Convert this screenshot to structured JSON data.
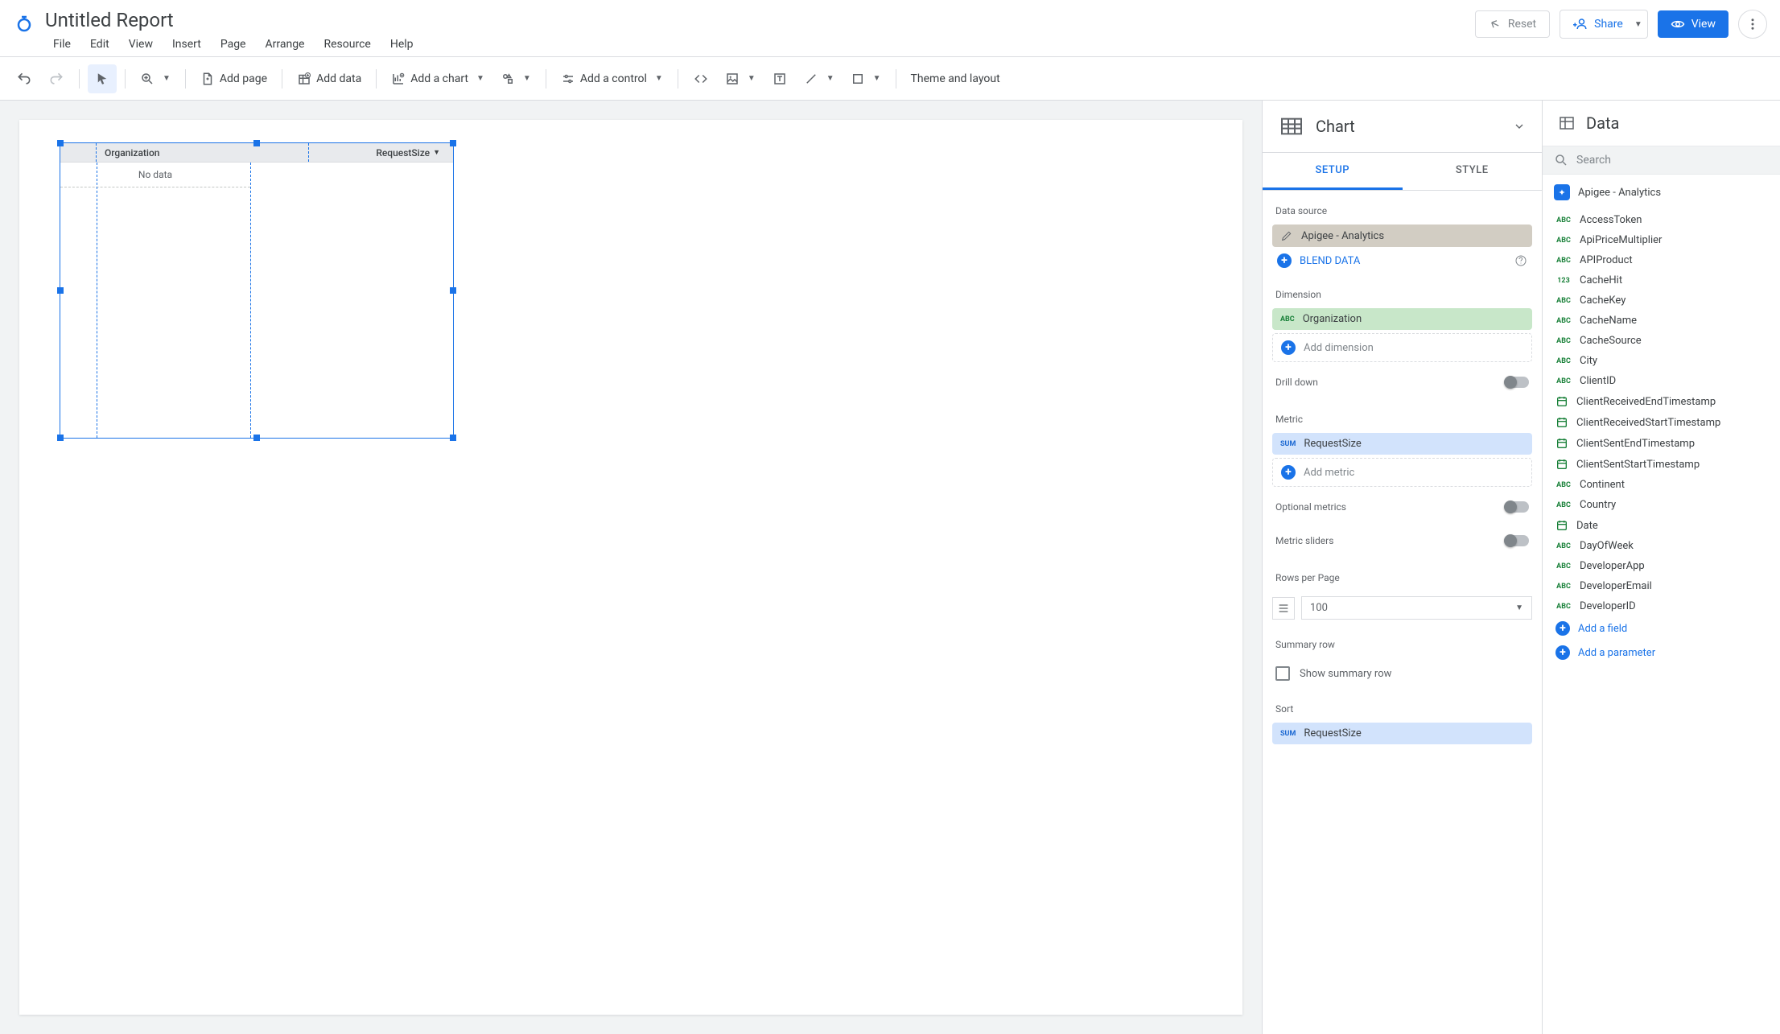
{
  "header": {
    "title": "Untitled Report",
    "menu": [
      "File",
      "Edit",
      "View",
      "Insert",
      "Page",
      "Arrange",
      "Resource",
      "Help"
    ],
    "reset": "Reset",
    "share": "Share",
    "view": "View"
  },
  "toolbar": {
    "add_page": "Add page",
    "add_data": "Add data",
    "add_chart": "Add a chart",
    "add_control": "Add a control",
    "theme": "Theme and layout"
  },
  "widget": {
    "col1": "Organization",
    "col2": "RequestSize",
    "nodata": "No data"
  },
  "chart_panel": {
    "title": "Chart",
    "tabs": {
      "setup": "SETUP",
      "style": "STYLE"
    },
    "data_source_label": "Data source",
    "data_source_value": "Apigee - Analytics",
    "blend": "BLEND DATA",
    "dimension_label": "Dimension",
    "dimension_value": "Organization",
    "add_dimension": "Add dimension",
    "drill_down": "Drill down",
    "metric_label": "Metric",
    "metric_badge": "SUM",
    "metric_value": "RequestSize",
    "add_metric": "Add metric",
    "optional_metrics": "Optional metrics",
    "metric_sliders": "Metric sliders",
    "rows_per_page_label": "Rows per Page",
    "rows_per_page_value": "100",
    "summary_row_label": "Summary row",
    "show_summary_row": "Show summary row",
    "sort_label": "Sort",
    "sort_value": "RequestSize"
  },
  "data_panel": {
    "title": "Data",
    "search_placeholder": "Search",
    "source": "Apigee - Analytics",
    "fields": [
      {
        "type": "ABC",
        "name": "AccessToken"
      },
      {
        "type": "ABC",
        "name": "ApiPriceMultiplier"
      },
      {
        "type": "ABC",
        "name": "APIProduct"
      },
      {
        "type": "123",
        "name": "CacheHit"
      },
      {
        "type": "ABC",
        "name": "CacheKey"
      },
      {
        "type": "ABC",
        "name": "CacheName"
      },
      {
        "type": "ABC",
        "name": "CacheSource"
      },
      {
        "type": "ABC",
        "name": "City"
      },
      {
        "type": "ABC",
        "name": "ClientID"
      },
      {
        "type": "DATE",
        "name": "ClientReceivedEndTimestamp"
      },
      {
        "type": "DATE",
        "name": "ClientReceivedStartTimestamp"
      },
      {
        "type": "DATE",
        "name": "ClientSentEndTimestamp"
      },
      {
        "type": "DATE",
        "name": "ClientSentStartTimestamp"
      },
      {
        "type": "ABC",
        "name": "Continent"
      },
      {
        "type": "ABC",
        "name": "Country"
      },
      {
        "type": "DATE",
        "name": "Date"
      },
      {
        "type": "ABC",
        "name": "DayOfWeek"
      },
      {
        "type": "ABC",
        "name": "DeveloperApp"
      },
      {
        "type": "ABC",
        "name": "DeveloperEmail"
      },
      {
        "type": "ABC",
        "name": "DeveloperID"
      }
    ],
    "add_field": "Add a field",
    "add_parameter": "Add a parameter"
  }
}
